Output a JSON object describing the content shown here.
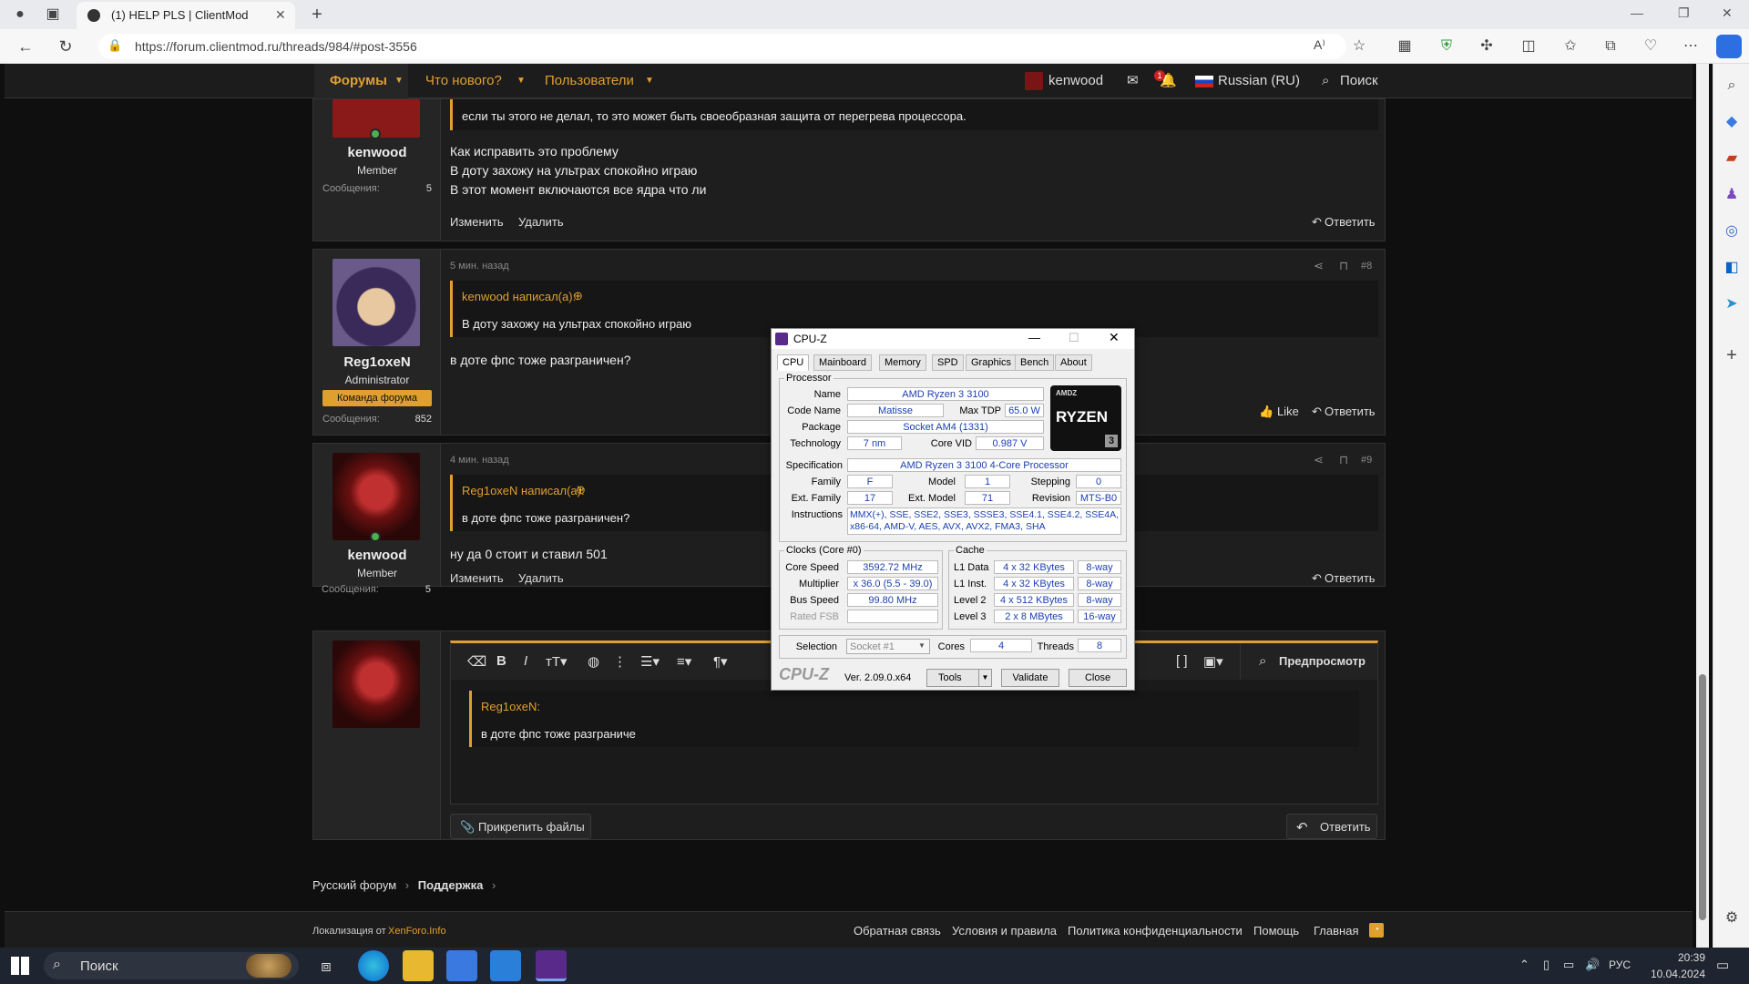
{
  "browser": {
    "tab_title": "(1) HELP PLS | ClientMod",
    "url": "https://forum.clientmod.ru/threads/984/#post-3556"
  },
  "nav": {
    "forums": "Форумы",
    "whats_new": "Что нового?",
    "users": "Пользователи",
    "user": "kenwood",
    "badge": "1",
    "language": "Russian (RU)",
    "search": "Поиск"
  },
  "post7": {
    "author": "kenwood",
    "role": "Member",
    "msgs_label": "Сообщения:",
    "msgs": "5",
    "quote": "если ты этого не делал, то это может быть своеобразная защита от перегрева процессора.",
    "line1": "Как исправить это проблему",
    "line2": "В доту захожу на ультрах спокойно играю",
    "line3": "В этот момент включаются все ядра что ли",
    "edit": "Изменить",
    "delete": "Удалить",
    "reply": "Ответить"
  },
  "post8": {
    "time": "5 мин. назад",
    "num": "#8",
    "author": "Reg1oxeN",
    "role": "Administrator",
    "badge": "Команда форума",
    "msgs_label": "Сообщения:",
    "msgs": "852",
    "quote_head": "kenwood написал(а):",
    "quote": "В доту захожу на ультрах спокойно играю",
    "body": "в доте фпс тоже разграничен?",
    "like": "Like",
    "reply": "Ответить"
  },
  "post9": {
    "time": "4 мин. назад",
    "num": "#9",
    "author": "kenwood",
    "role": "Member",
    "msgs_label": "Сообщения:",
    "msgs": "5",
    "quote_head": "Reg1oxeN написал(а):",
    "quote": "в доте фпс тоже разграничен?",
    "body": "ну да 0 стоит и ставил 501",
    "edit": "Изменить",
    "delete": "Удалить",
    "reply": "Ответить"
  },
  "editor": {
    "preview": "Предпросмотр",
    "quote_head": "Reg1oxeN:",
    "quote": "в доте фпс тоже разграниче",
    "attach": "Прикрепить файлы",
    "reply": "Ответить"
  },
  "breadcrumb": {
    "root": "Русский форум",
    "current": "Поддержка"
  },
  "footer": {
    "loc_prefix": "Локализация от",
    "loc_link": "XenForo.Info",
    "links": [
      "Обратная связь",
      "Условия и правила",
      "Политика конфиденциальности",
      "Помощь",
      "Главная"
    ]
  },
  "cpuz": {
    "title": "CPU-Z",
    "tabs": [
      "CPU",
      "Mainboard",
      "Memory",
      "SPD",
      "Graphics",
      "Bench",
      "About"
    ],
    "processor_legend": "Processor",
    "name_lbl": "Name",
    "name": "AMD Ryzen 3 3100",
    "codename_lbl": "Code Name",
    "codename": "Matisse",
    "maxtdp_lbl": "Max TDP",
    "maxtdp": "65.0 W",
    "package_lbl": "Package",
    "package": "Socket AM4 (1331)",
    "tech_lbl": "Technology",
    "tech": "7 nm",
    "corevid_lbl": "Core VID",
    "corevid": "0.987 V",
    "spec_lbl": "Specification",
    "spec": "AMD Ryzen 3 3100 4-Core Processor",
    "family_lbl": "Family",
    "family": "F",
    "model_lbl": "Model",
    "model": "1",
    "stepping_lbl": "Stepping",
    "stepping": "0",
    "extfam_lbl": "Ext. Family",
    "extfam": "17",
    "extmodel_lbl": "Ext. Model",
    "extmodel": "71",
    "revision_lbl": "Revision",
    "revision": "MTS-B0",
    "instr_lbl": "Instructions",
    "instr1": "MMX(+), SSE, SSE2, SSE3, SSSE3, SSE4.1, SSE4.2, SSE4A,",
    "instr2": "x86-64, AMD-V, AES, AVX, AVX2, FMA3, SHA",
    "clocks_legend": "Clocks (Core #0)",
    "corespeed_lbl": "Core Speed",
    "corespeed": "3592.72 MHz",
    "mult_lbl": "Multiplier",
    "mult": "x 36.0 (5.5 - 39.0)",
    "bus_lbl": "Bus Speed",
    "bus": "99.80 MHz",
    "fsb_lbl": "Rated FSB",
    "cache_legend": "Cache",
    "l1d_lbl": "L1 Data",
    "l1d": "4 x 32 KBytes",
    "l1d_w": "8-way",
    "l1i_lbl": "L1 Inst.",
    "l1i": "4 x 32 KBytes",
    "l1i_w": "8-way",
    "l2_lbl": "Level 2",
    "l2": "4 x 512 KBytes",
    "l2_w": "8-way",
    "l3_lbl": "Level 3",
    "l3": "2 x 8 MBytes",
    "l3_w": "16-way",
    "selection_lbl": "Selection",
    "selection": "Socket #1",
    "cores_lbl": "Cores",
    "cores": "4",
    "threads_lbl": "Threads",
    "threads": "8",
    "brand": "CPU-Z",
    "version": "Ver. 2.09.0.x64",
    "tools": "Tools",
    "validate": "Validate",
    "close": "Close",
    "logo_top": "AMDZ",
    "logo_main": "RYZEN",
    "logo_num": "3"
  },
  "taskbar": {
    "search": "Поиск",
    "lang": "РУС",
    "time": "20:39",
    "date": "10.04.2024"
  }
}
